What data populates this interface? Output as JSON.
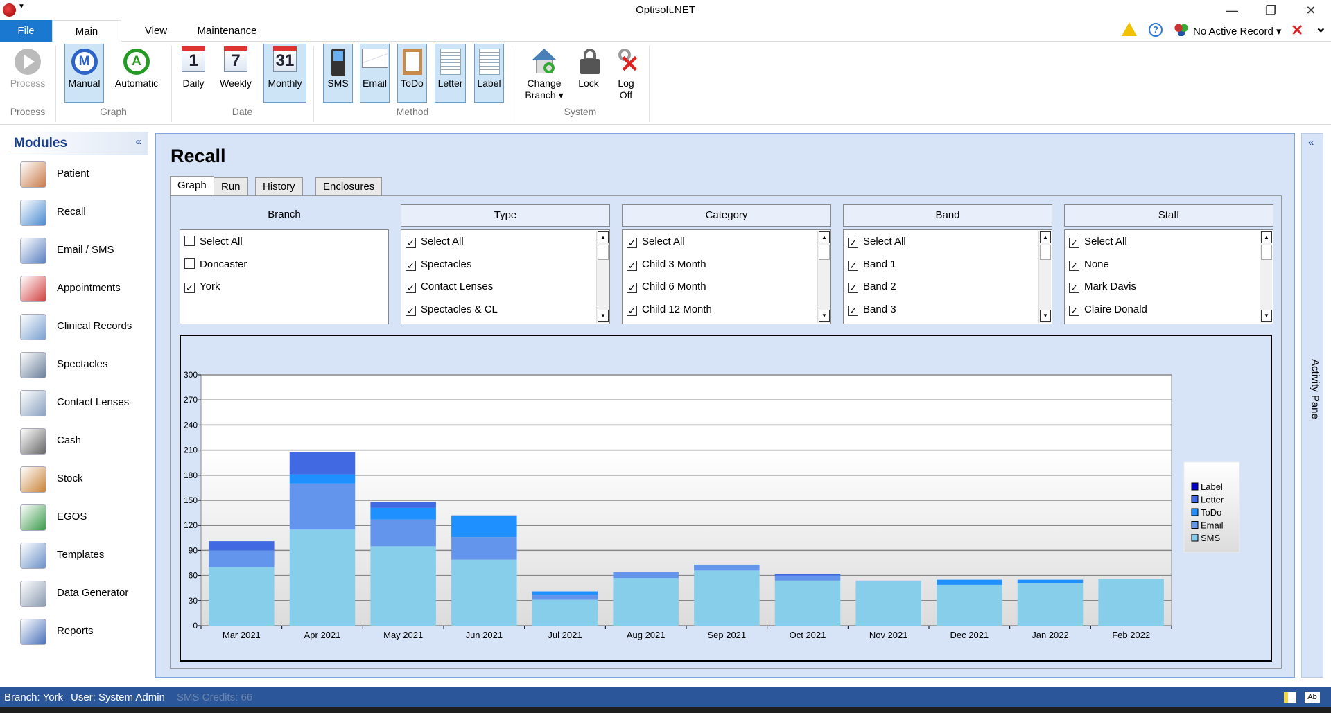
{
  "window": {
    "title": "Optisoft.NET",
    "min": "—",
    "max": "❐",
    "close": "✕"
  },
  "tabs": [
    "File",
    "Main",
    "View",
    "Maintenance"
  ],
  "toolbar_right": {
    "record": "No Active Record ▾",
    "close": "✕",
    "chevron": "⌄"
  },
  "ribbon": {
    "buttons": [
      {
        "label": "Process",
        "icon": "play-icon"
      },
      {
        "label": "Manual",
        "icon": "m-circle-icon",
        "selected": true
      },
      {
        "label": "Automatic",
        "icon": "a-circle-icon"
      },
      {
        "label": "Daily",
        "icon": "calendar-1-icon",
        "cal": "1"
      },
      {
        "label": "Weekly",
        "icon": "calendar-7-icon",
        "cal": "7"
      },
      {
        "label": "Monthly",
        "icon": "calendar-31-icon",
        "cal": "31",
        "selected": true
      },
      {
        "label": "SMS",
        "icon": "mobile-phone-icon",
        "selected": true
      },
      {
        "label": "Email",
        "icon": "envelope-icon",
        "selected": true
      },
      {
        "label": "ToDo",
        "icon": "clipboard-icon",
        "selected": true
      },
      {
        "label": "Letter",
        "icon": "letter-pencil-icon",
        "selected": true
      },
      {
        "label": "Label",
        "icon": "label-pencil-icon",
        "selected": true
      },
      {
        "label": "Change",
        "label2": "Branch ▾",
        "icon": "house-refresh-icon"
      },
      {
        "label": "Lock",
        "icon": "padlock-icon"
      },
      {
        "label": "Log",
        "label2": "Off",
        "icon": "key-x-icon"
      }
    ],
    "groups": [
      "Process",
      "Graph",
      "Date",
      "Method",
      "System"
    ]
  },
  "sidebar": {
    "title": "Modules",
    "collapse": "«",
    "items": [
      "Patient",
      "Recall",
      "Email / SMS",
      "Appointments",
      "Clinical Records",
      "Spectacles",
      "Contact Lenses",
      "Cash",
      "Stock",
      "EGOS",
      "Templates",
      "Data Generator",
      "Reports"
    ]
  },
  "main": {
    "title": "Recall",
    "tabs": [
      "Graph",
      "Run",
      "History",
      "Enclosures"
    ],
    "filters": [
      {
        "header": "Branch",
        "items": [
          {
            "label": "Select All",
            "checked": false
          },
          {
            "label": "Doncaster",
            "checked": false
          },
          {
            "label": "York",
            "checked": true
          }
        ]
      },
      {
        "header": "Type",
        "items": [
          {
            "label": "Select All",
            "checked": true
          },
          {
            "label": "Spectacles",
            "checked": true
          },
          {
            "label": "Contact Lenses",
            "checked": true
          },
          {
            "label": "Spectacles & CL",
            "checked": true
          }
        ]
      },
      {
        "header": "Category",
        "items": [
          {
            "label": "Select All",
            "checked": true
          },
          {
            "label": "Child 3 Month",
            "checked": true
          },
          {
            "label": "Child 6 Month",
            "checked": true
          },
          {
            "label": "Child 12 Month",
            "checked": true
          }
        ]
      },
      {
        "header": "Band",
        "items": [
          {
            "label": "Select All",
            "checked": true
          },
          {
            "label": "Band 1",
            "checked": true
          },
          {
            "label": "Band 2",
            "checked": true
          },
          {
            "label": "Band 3",
            "checked": true
          }
        ]
      },
      {
        "header": "Staff",
        "items": [
          {
            "label": "Select All",
            "checked": true
          },
          {
            "label": "None",
            "checked": true
          },
          {
            "label": "Mark Davis",
            "checked": true
          },
          {
            "label": "Claire Donald",
            "checked": true
          }
        ]
      }
    ]
  },
  "activity_pane": {
    "label": "Activity Pane",
    "collapse": "«"
  },
  "status": {
    "branch": "Branch: York",
    "user": "User: System Admin",
    "sms": "SMS Credits: 66"
  },
  "chart_data": {
    "type": "bar",
    "stacked": true,
    "categories": [
      "Mar 2021",
      "Apr 2021",
      "May 2021",
      "Jun 2021",
      "Jul 2021",
      "Aug 2021",
      "Sep 2021",
      "Oct 2021",
      "Nov 2021",
      "Dec 2021",
      "Jan 2022",
      "Feb 2022"
    ],
    "ylim": [
      0,
      300
    ],
    "yticks": [
      0,
      30,
      60,
      90,
      120,
      150,
      180,
      210,
      240,
      270,
      300
    ],
    "grid": true,
    "legend": "right",
    "series": [
      {
        "name": "SMS",
        "color": "#87ceeb",
        "values": [
          70,
          115,
          95,
          79,
          31,
          57,
          66,
          54,
          54,
          49,
          51,
          56
        ]
      },
      {
        "name": "Email",
        "color": "#6495ed",
        "values": [
          20,
          55,
          32,
          27,
          6,
          7,
          7,
          6,
          0,
          0,
          0,
          0
        ]
      },
      {
        "name": "ToDo",
        "color": "#1e90ff",
        "values": [
          0,
          11,
          14,
          25,
          4,
          0,
          0,
          0,
          0,
          6,
          4,
          0
        ]
      },
      {
        "name": "Letter",
        "color": "#4169e1",
        "values": [
          11,
          27,
          7,
          1,
          0,
          0,
          0,
          2,
          0,
          0,
          0,
          0
        ]
      },
      {
        "name": "Label",
        "color": "#0000cd",
        "values": [
          0,
          0,
          0,
          0,
          0,
          0,
          0,
          0,
          0,
          0,
          0,
          0
        ]
      }
    ]
  }
}
